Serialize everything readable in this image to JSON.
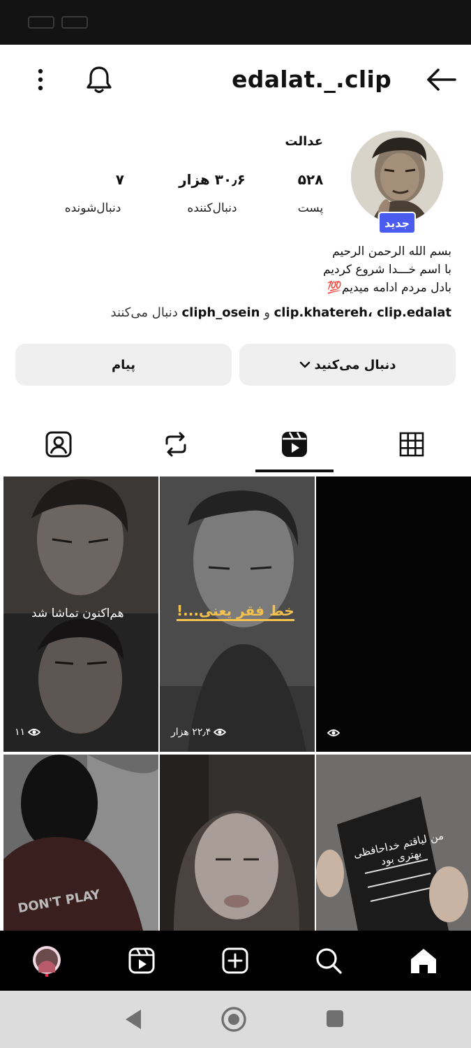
{
  "header": {
    "username": "edalat._.clip"
  },
  "profile": {
    "display_name": "عدالت",
    "badge": "جدید",
    "stats": [
      {
        "value": "۵۲۸",
        "label": "پست"
      },
      {
        "value": "۳۰٫۶ هزار",
        "label": "دنبال‌کننده"
      },
      {
        "value": "۷",
        "label": "دنبال‌شونده"
      }
    ],
    "bio": [
      "بسم الله الرحمن الرحیم",
      "با اسم خـــدا شروع کردیم",
      "بادل مردم ادامه میدیم💯"
    ],
    "followed_by": {
      "names1": "clip.khatereh، clip.edalat",
      "joiner": " و ",
      "names2": "cliph_osein",
      "suffix": " دنبال می‌کنند"
    }
  },
  "actions": {
    "follow_label": "دنبال می‌کنید",
    "message_label": "پیام"
  },
  "tabs": [
    "tagged-icon",
    "reposts-icon",
    "reels-icon",
    "grid-icon"
  ],
  "grid": {
    "items": [
      {
        "overlay": "هم‌اکنون تماشا شد",
        "views": "۱۱"
      },
      {
        "overlay": "خط فقر یعنی...!",
        "views": "۲۲٫۴ هزار"
      },
      {
        "overlay": "",
        "views": ""
      },
      {
        "overlay": "DON'T PLAY",
        "views": ""
      },
      {
        "overlay": "",
        "views": ""
      },
      {
        "overlay": "من لیاقتم خداحافظی بهتری بود",
        "views": ""
      }
    ]
  },
  "bottom_nav": [
    "profile-avatar",
    "reels-icon",
    "create-icon",
    "search-icon",
    "home-icon"
  ],
  "colors": {
    "badge": "#4a5cf0",
    "button_bg": "#efefef",
    "accent_text": "#f2c14e"
  }
}
